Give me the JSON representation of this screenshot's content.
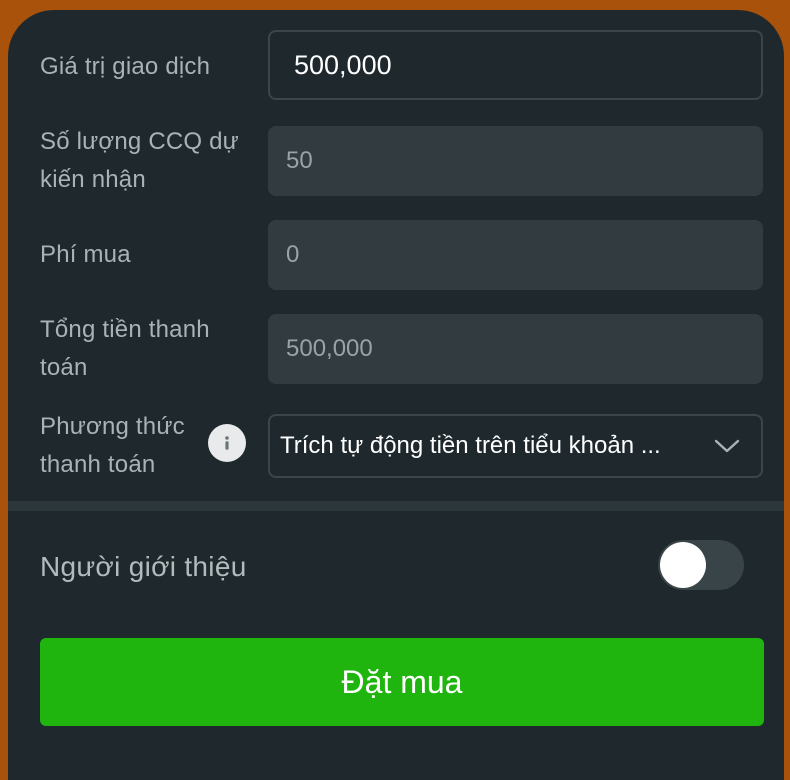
{
  "form": {
    "transaction_value": {
      "label": "Giá trị giao dịch",
      "value": "500,000"
    },
    "expected_units": {
      "label_line1": "Số lượng CCQ dự",
      "label_line2": "kiến nhận",
      "value": "50"
    },
    "purchase_fee": {
      "label": "Phí mua",
      "value": "0"
    },
    "total_payment": {
      "label_line1": "Tổng tiền thanh",
      "label_line2": "toán",
      "value": "500,000"
    },
    "payment_method": {
      "label_line1": "Phương thức",
      "label_line2": "thanh toán",
      "selected": "Trích tự động tiền trên tiểu khoản ...",
      "icon": "info-icon"
    }
  },
  "referrer": {
    "label": "Người giới thiệu",
    "enabled": false
  },
  "submit": {
    "label": "Đặt mua"
  },
  "colors": {
    "panel_bg": "#1f292d",
    "outer_bg": "#a8520b",
    "readonly_field": "#323c40",
    "accent_green": "#20b50e"
  }
}
